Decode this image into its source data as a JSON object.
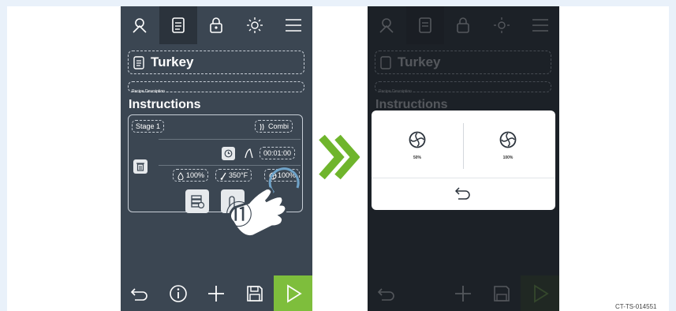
{
  "colors": {
    "panel": "#3b4652",
    "accent_green": "#7ebe3c",
    "chevron_green": "#6fb52c"
  },
  "left_screen": {
    "top_tabs": [
      "user-icon",
      "recipe-icon",
      "lock-icon",
      "brightness-icon",
      "menu-icon"
    ],
    "recipe_title": "Turkey",
    "recipe_description_placeholder": "Recipe Description",
    "instructions_heading": "Instructions",
    "stage_label": "Stage 1",
    "mode_label": "Combi",
    "timer": "00:01:00",
    "humidity": "100%",
    "temperature": "350°F",
    "fan_speed": "100%",
    "step_number": "⑪",
    "bottom_bar": [
      "back-icon",
      "info-icon",
      "add-icon",
      "save-icon",
      "play-icon"
    ]
  },
  "right_screen": {
    "recipe_title": "Turkey",
    "recipe_description_placeholder": "Recipe Description",
    "instructions_heading": "Instructions",
    "popup": {
      "options": [
        {
          "label": "50%",
          "icon": "fan-icon"
        },
        {
          "label": "100%",
          "icon": "fan-icon"
        }
      ],
      "back_icon": "back-icon"
    }
  },
  "caption": "CT-TS-014551"
}
